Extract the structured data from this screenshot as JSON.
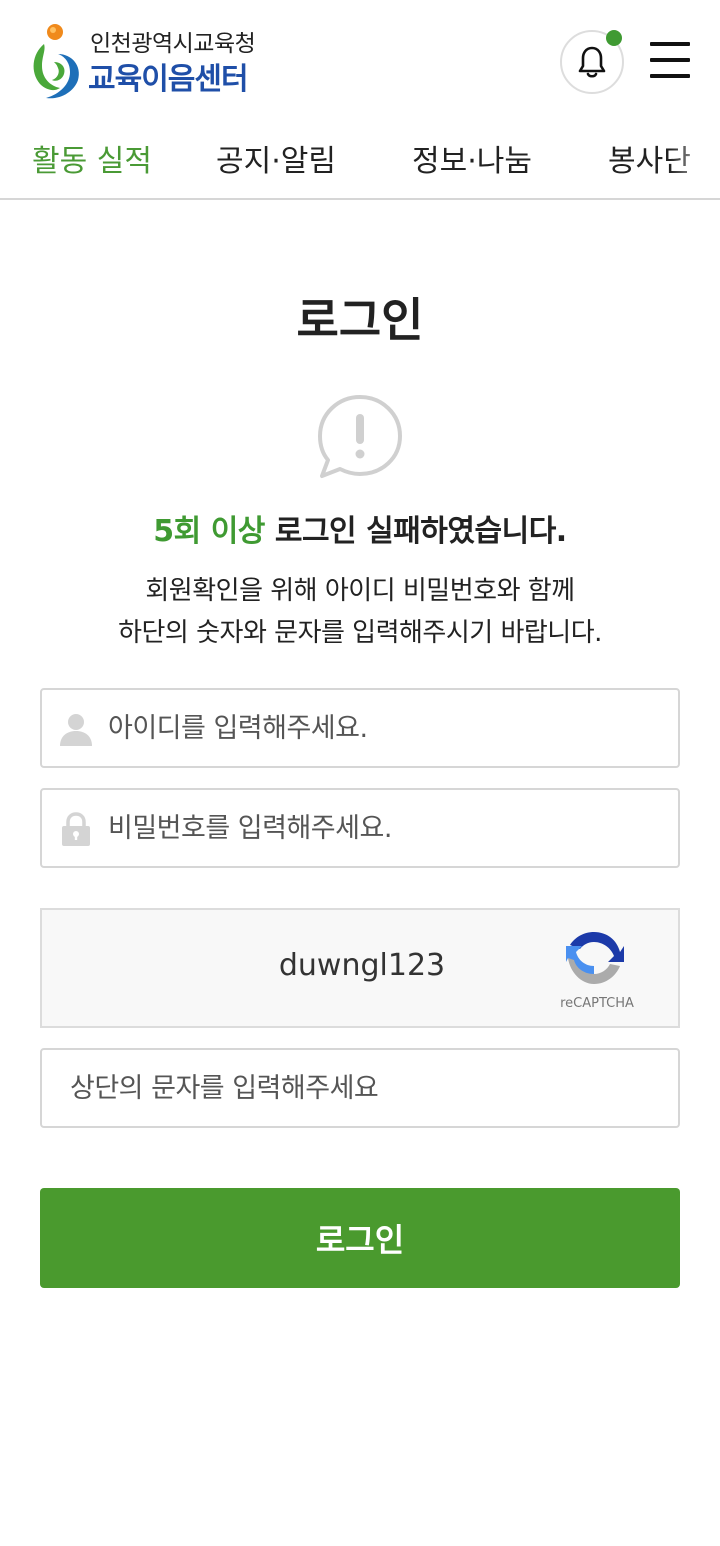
{
  "header": {
    "logo_line1": "인천광역시교육청",
    "logo_line2": "교육이음센터",
    "bell_icon": "bell-icon",
    "menu_icon": "hamburger-menu-icon",
    "notification_color": "#3f9a32",
    "brand_blue": "#1f4fa8"
  },
  "nav": {
    "items": [
      {
        "label": "활동 실적",
        "active": true
      },
      {
        "label": "공지·알림",
        "active": false
      },
      {
        "label": "정보·나눔",
        "active": false
      },
      {
        "label": "봉사단",
        "active": false
      }
    ],
    "active_color": "#4a9a35"
  },
  "main": {
    "title": "로그인",
    "alert_icon": "speech-bubble-exclamation-icon",
    "fail_highlight": "5회 이상",
    "fail_rest": " 로그인 실패하였습니다.",
    "desc_line1": "회원확인을 위해 아이디 비밀번호와 함께",
    "desc_line2": "하단의 숫자와 문자를 입력해주시기 바랍니다."
  },
  "form": {
    "id_placeholder": "아이디를 입력해주세요.",
    "id_icon": "user-icon",
    "password_placeholder": "비밀번호를 입력해주세요.",
    "password_icon": "lock-icon",
    "captcha_text": "duwngl123",
    "recaptcha_label": "reCAPTCHA",
    "captcha_placeholder": "상단의 문자를 입력해주세요",
    "login_button": "로그인",
    "button_color": "#4a9a2e"
  }
}
